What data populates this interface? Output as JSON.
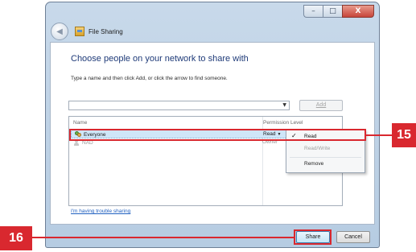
{
  "window": {
    "title": "File Sharing",
    "controls": {
      "minimize": "–",
      "maximize": "□",
      "close": "X"
    }
  },
  "dialog": {
    "heading": "Choose people on your network to share with",
    "instruction": "Type a name and then click Add, or click the arrow to find someone.",
    "name_input_value": "",
    "add_button": "Add",
    "columns": {
      "name": "Name",
      "permission": "Permission Level"
    },
    "rows": [
      {
        "name": "Everyone",
        "permission": "Read",
        "selected": true
      },
      {
        "name": "NAD",
        "permission": "Owner",
        "selected": false
      }
    ],
    "permission_menu": {
      "items": [
        {
          "label": "Read",
          "checked": true,
          "enabled": true
        },
        {
          "label": "Read/Write",
          "checked": false,
          "enabled": false
        },
        {
          "label": "Remove",
          "checked": false,
          "enabled": true
        }
      ]
    },
    "trouble_link": "I'm having trouble sharing",
    "share_button": "Share",
    "cancel_button": "Cancel"
  },
  "callouts": {
    "c15": "15",
    "c16": "16",
    "color": "#d9282f"
  }
}
